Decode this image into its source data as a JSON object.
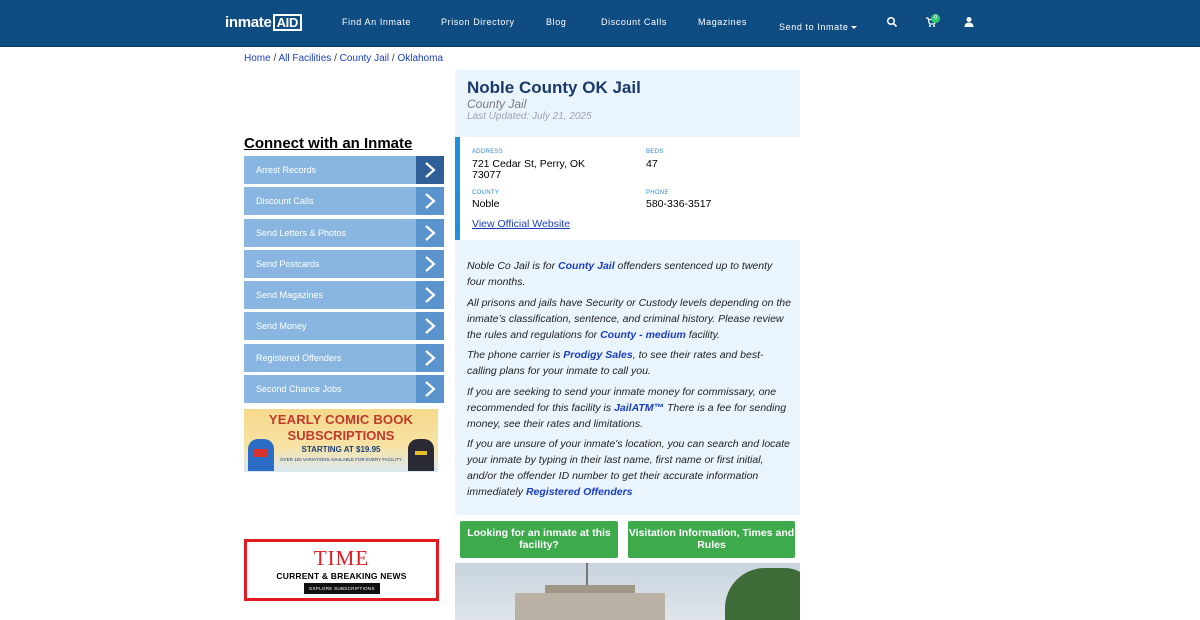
{
  "header": {
    "logo_main": "inmate",
    "logo_suffix": "AID",
    "nav": [
      "Find An Inmate",
      "Prison Directory",
      "Blog",
      "Discount Calls",
      "Magazines",
      "Send to Inmate"
    ],
    "cart_count": "0"
  },
  "breadcrumb": {
    "items": [
      "Home",
      "All Facilities",
      "County Jail",
      "Oklahoma"
    ],
    "separator": "/"
  },
  "sidebar": {
    "title": "Connect with an Inmate",
    "items": [
      "Arrest Records",
      "Discount Calls",
      "Send Letters & Photos",
      "Send Postcards",
      "Send Magazines",
      "Send Money",
      "Registered Offenders",
      "Second Chance Jobs"
    ]
  },
  "ads": {
    "comic": {
      "line1": "YEARLY COMIC BOOK",
      "line2": "SUBSCRIPTIONS",
      "line3": "STARTING AT $19.95",
      "line4": "OVER 150 VARIATIONS AVAILABLE FOR EVERY FACILITY"
    },
    "time": {
      "brand": "TIME",
      "tagline": "CURRENT & BREAKING NEWS",
      "cta": "EXPLORE SUBSCRIPTIONS"
    }
  },
  "facility": {
    "name": "Noble County OK Jail",
    "type": "County Jail",
    "updated": "Last Updated: July 21, 2025",
    "address_label": "ADDRESS",
    "address_line1": "721 Cedar St, Perry, OK",
    "address_line2": "73077",
    "beds_label": "BEDS",
    "beds": "47",
    "county_label": "COUNTY",
    "county": "Noble",
    "phone_label": "PHONE",
    "phone": "580-336-3517",
    "website_link": "View Official Website"
  },
  "description": {
    "p1_a": "Noble Co Jail is for ",
    "p1_link": "County Jail",
    "p1_b": " offenders sentenced up to twenty four months.",
    "p2_a": "All prisons and jails have Security or Custody levels depending on the inmate’s classification, sentence, and criminal history. Please review the rules and regulations for ",
    "p2_link": "County - medium",
    "p2_b": " facility.",
    "p3_a": "The phone carrier is ",
    "p3_link": "Prodigy Sales",
    "p3_b": ", to see their rates and best-calling plans for your inmate to call you.",
    "p4_a": "If you are seeking to send your inmate money for commissary, one recommended for this facility is ",
    "p4_link": "JailATM™",
    "p4_b": " There is a fee for sending money, see their rates and limitations.",
    "p5_a": "If you are unsure of your inmate's location, you can search and locate your inmate by typing in their last name, first name or first initial, and/or the offender ID number to get their accurate information immediately ",
    "p5_link": "Registered Offenders"
  },
  "buttons": {
    "looking": "Looking for an inmate at this facility?",
    "visitation": "Visitation Information, Times and Rules"
  },
  "colors": {
    "header_bg": "#0f4c81",
    "link": "#1a3fbf",
    "button_green": "#3daa4c",
    "menu_bg": "#89b6e1",
    "panel_bg": "#eaf4fd"
  }
}
